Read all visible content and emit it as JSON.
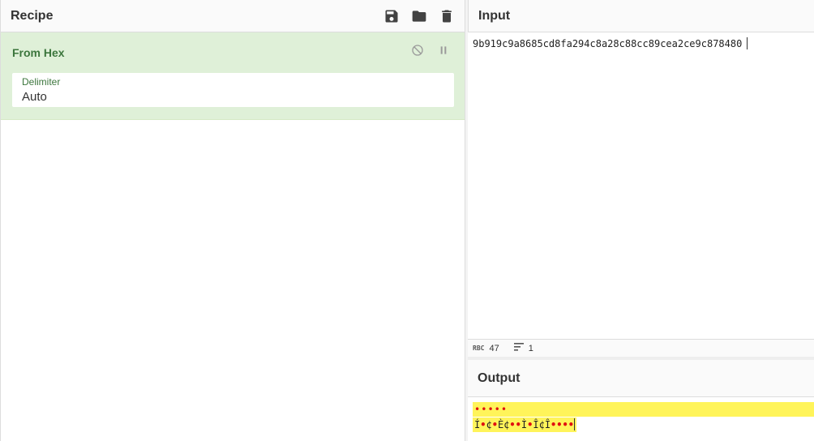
{
  "recipe": {
    "title": "Recipe",
    "tools": [
      "save-icon",
      "folder-icon",
      "trash-icon"
    ],
    "operation": {
      "name": "From Hex",
      "controls": [
        "disable-icon",
        "pause-icon"
      ],
      "arg_label": "Delimiter",
      "arg_value": "Auto"
    }
  },
  "input": {
    "title": "Input",
    "text": "9b919c9a8685cd8fa294c8a28c88cc89cea2ce9c878480",
    "status": {
      "chars": "47",
      "lines": "1",
      "chars_icon": "abc-icon",
      "lines_icon": "lines-icon"
    }
  },
  "output": {
    "title": "Output",
    "line1": "•••••",
    "line2": "Í•¢•È¢••Ì•Î¢Î••••"
  },
  "colors": {
    "operation_bg": "#dff0d8",
    "operation_text": "#3c763d",
    "highlight": "#fff45a",
    "control_char": "#e01010"
  }
}
